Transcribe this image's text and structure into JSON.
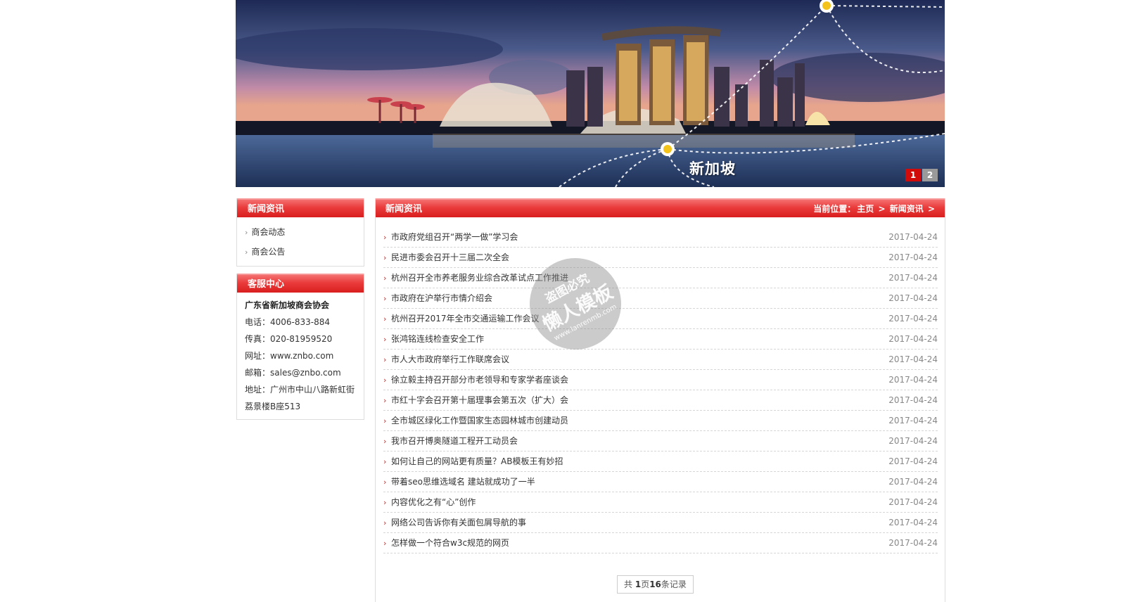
{
  "banner": {
    "caption": "新加坡",
    "slides": [
      "1",
      "2"
    ],
    "active_slide": 1
  },
  "sidebar": {
    "news_panel": {
      "title": "新闻资讯",
      "items": [
        {
          "label": "商会动态"
        },
        {
          "label": "商会公告"
        }
      ]
    },
    "service_panel": {
      "title": "客服中心",
      "org": "广东省新加坡商会协会",
      "phone": "电话：4006-833-884",
      "fax": "传真：020-81959520",
      "website": "网址：www.znbo.com",
      "email": "邮箱：sales@znbo.com",
      "address_line1": "地址：广州市中山八路新虹街",
      "address_line2": "荔景楼B座513"
    }
  },
  "main": {
    "title": "新闻资讯",
    "breadcrumb": {
      "prefix": "当前位置：",
      "home": "主页",
      "sep": ">",
      "current": "新闻资讯",
      "tail": ">"
    },
    "news": [
      {
        "title": "市政府党组召开“两学一做”学习会",
        "date": "2017-04-24"
      },
      {
        "title": "民进市委会召开十三届二次全会",
        "date": "2017-04-24"
      },
      {
        "title": "杭州召开全市养老服务业综合改革试点工作推进",
        "date": "2017-04-24"
      },
      {
        "title": "市政府在沪举行市情介绍会",
        "date": "2017-04-24"
      },
      {
        "title": "杭州召开2017年全市交通运输工作会议",
        "date": "2017-04-24"
      },
      {
        "title": "张鸿铭连线检查安全工作",
        "date": "2017-04-24"
      },
      {
        "title": "市人大市政府举行工作联席会议",
        "date": "2017-04-24"
      },
      {
        "title": "徐立毅主持召开部分市老领导和专家学者座谈会",
        "date": "2017-04-24"
      },
      {
        "title": "市红十字会召开第十届理事会第五次（扩大）会",
        "date": "2017-04-24"
      },
      {
        "title": "全市城区绿化工作暨国家生态园林城市创建动员",
        "date": "2017-04-24"
      },
      {
        "title": "我市召开博奥隧道工程开工动员会",
        "date": "2017-04-24"
      },
      {
        "title": "如何让自己的网站更有质量？AB模板王有妙招",
        "date": "2017-04-24"
      },
      {
        "title": "带着seo思维选域名 建站就成功了一半",
        "date": "2017-04-24"
      },
      {
        "title": "内容优化之有“心”创作",
        "date": "2017-04-24"
      },
      {
        "title": "网络公司告诉你有关面包屑导航的事",
        "date": "2017-04-24"
      },
      {
        "title": "怎样做一个符合w3c规范的网页",
        "date": "2017-04-24"
      }
    ],
    "pager": {
      "p1": "共 ",
      "pages": "1",
      "p2": "页",
      "count": "16",
      "p3": "条记录"
    }
  },
  "watermark": {
    "line1": "盗图必究",
    "line2": "懒人模板",
    "line3": "www.lanrenmb.com"
  }
}
